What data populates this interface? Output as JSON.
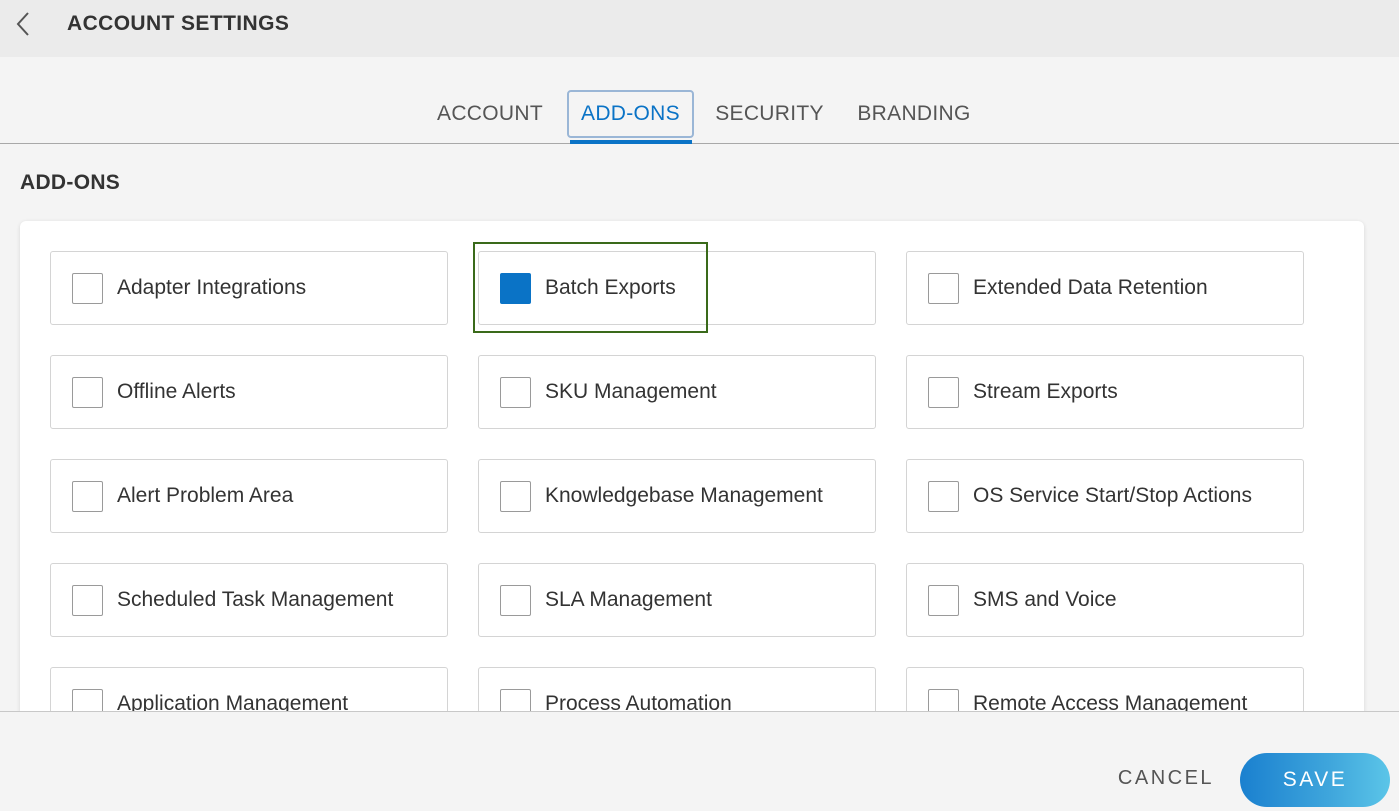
{
  "header": {
    "title": "ACCOUNT SETTINGS",
    "back_icon": "chevron-left-icon"
  },
  "tabs": [
    {
      "label": "ACCOUNT",
      "active": false
    },
    {
      "label": "ADD-ONS",
      "active": true
    },
    {
      "label": "SECURITY",
      "active": false
    },
    {
      "label": "BRANDING",
      "active": false
    }
  ],
  "section": {
    "title": "ADD-ONS"
  },
  "addons": [
    {
      "label": "Adapter Integrations",
      "checked": false
    },
    {
      "label": "Batch Exports",
      "checked": true
    },
    {
      "label": "Extended Data Retention",
      "checked": false
    },
    {
      "label": "Offline Alerts",
      "checked": false
    },
    {
      "label": "SKU Management",
      "checked": false
    },
    {
      "label": "Stream Exports",
      "checked": false
    },
    {
      "label": "Alert Problem Area",
      "checked": false
    },
    {
      "label": "Knowledgebase Management",
      "checked": false
    },
    {
      "label": "OS Service Start/Stop Actions",
      "checked": false
    },
    {
      "label": "Scheduled Task Management",
      "checked": false
    },
    {
      "label": "SLA Management",
      "checked": false
    },
    {
      "label": "SMS and Voice",
      "checked": false
    },
    {
      "label": "Application Management",
      "checked": false
    },
    {
      "label": "Process Automation",
      "checked": false
    },
    {
      "label": "Remote Access Management",
      "checked": false
    }
  ],
  "footer": {
    "cancel_label": "CANCEL",
    "save_label": "SAVE"
  },
  "colors": {
    "accent": "#0a73c6",
    "focus": "#3a6a1a"
  }
}
